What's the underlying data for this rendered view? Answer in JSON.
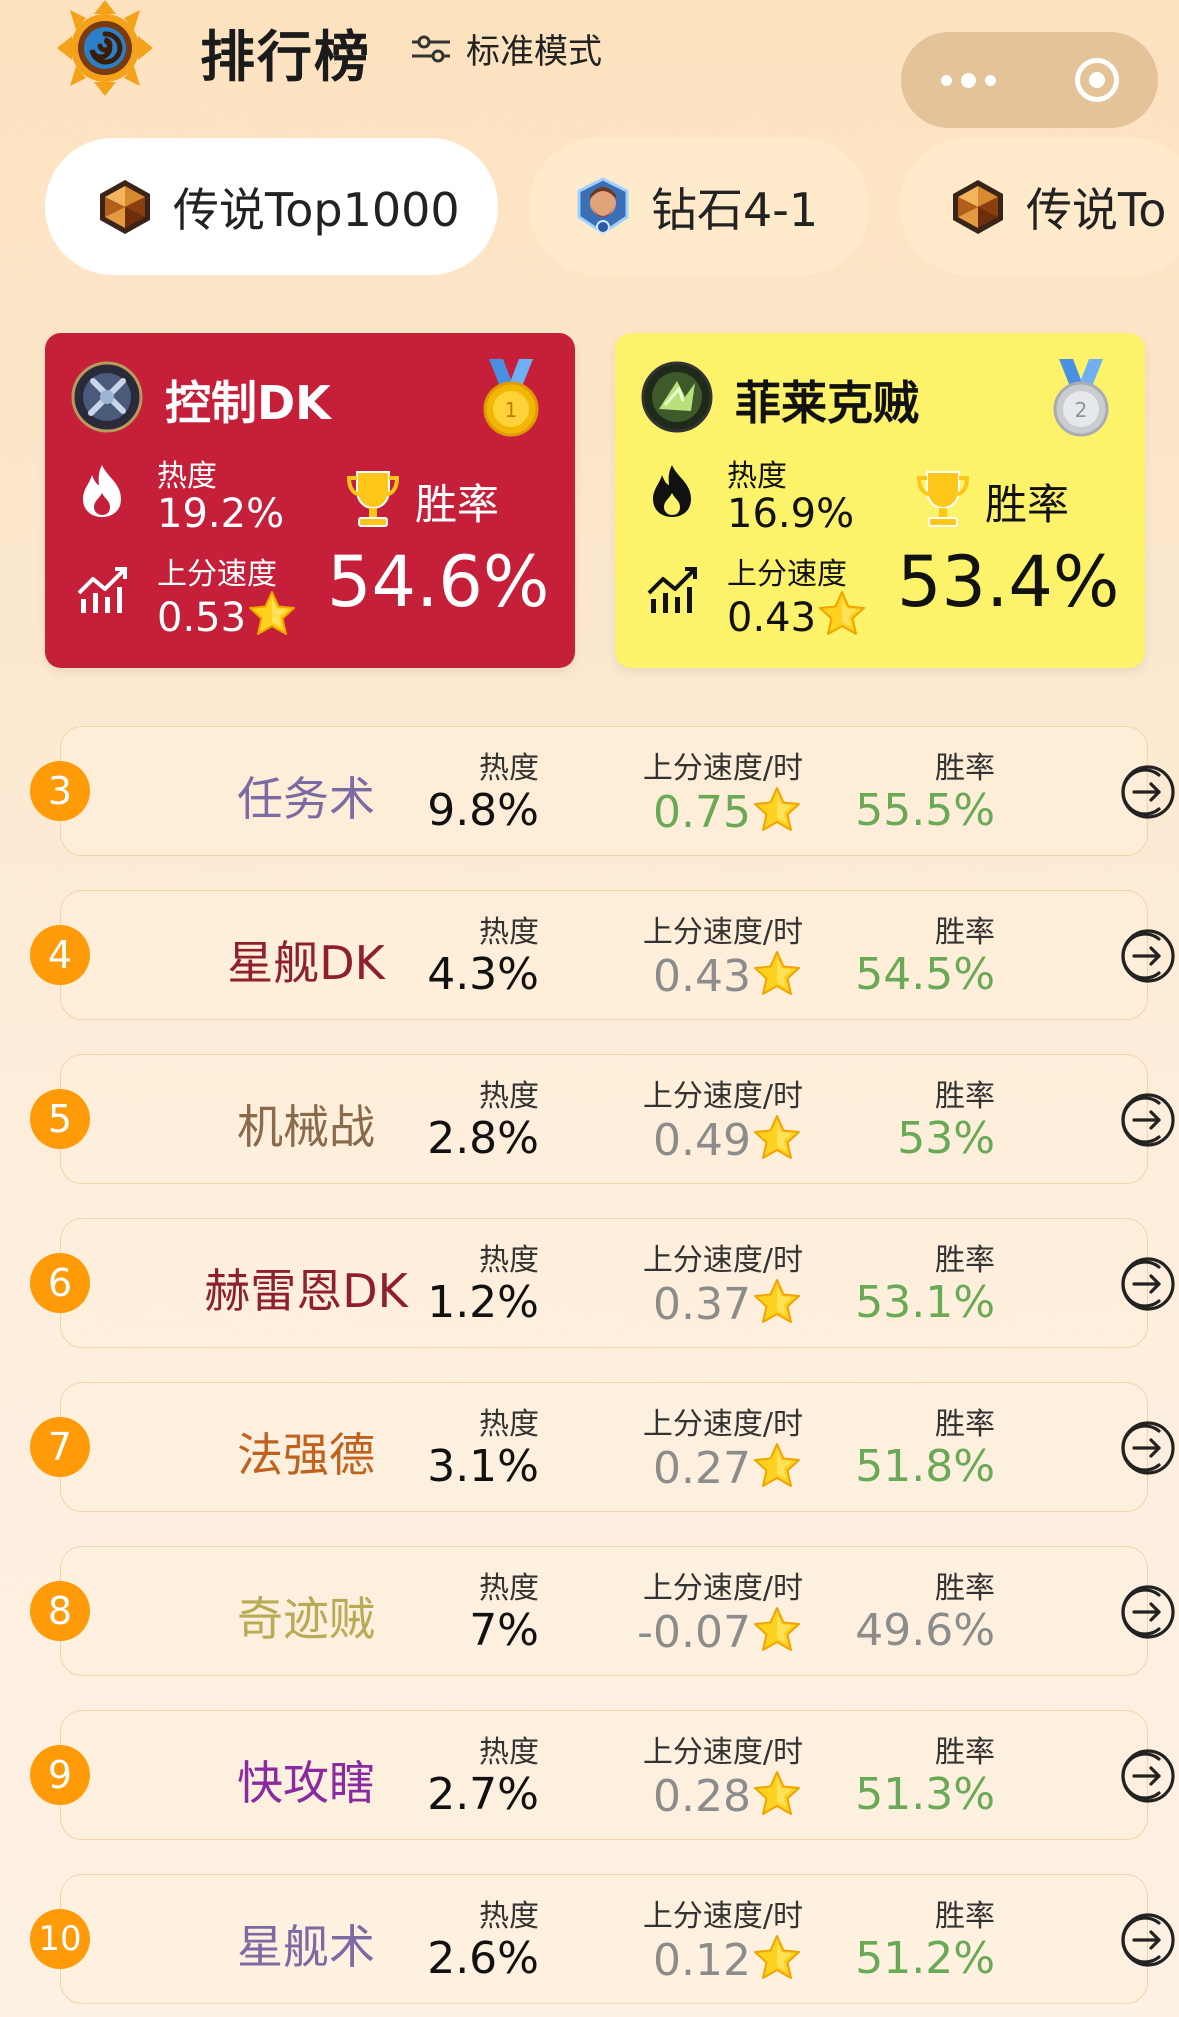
{
  "header": {
    "title": "排行榜",
    "mode_label": "标准模式"
  },
  "tabs": [
    {
      "label": "传说Top1000",
      "active": true,
      "icon": "legend-gem-icon"
    },
    {
      "label": "钻石4-1",
      "active": false,
      "icon": "diamond-rank-icon"
    },
    {
      "label": "传说To",
      "active": false,
      "icon": "legend-gem-icon"
    }
  ],
  "top_cards": [
    {
      "rank": 1,
      "name": "控制DK",
      "heat_label": "热度",
      "heat": "19.2%",
      "speed_label": "上分速度",
      "speed": "0.53",
      "winrate_label": "胜率",
      "winrate": "54.6%",
      "color": "#c51f3a",
      "medal": "gold-medal-icon"
    },
    {
      "rank": 2,
      "name": "菲莱克贼",
      "heat_label": "热度",
      "heat": "16.9%",
      "speed_label": "上分速度",
      "speed": "0.43",
      "winrate_label": "胜率",
      "winrate": "53.4%",
      "color": "#fdf36b",
      "medal": "silver-medal-icon"
    }
  ],
  "columns": {
    "heat": "热度",
    "speed": "上分速度/时",
    "winrate": "胜率"
  },
  "rows": [
    {
      "rank": "3",
      "name": "任务术",
      "name_color": "#7b6aa3",
      "heat": "9.8%",
      "speed": "0.75",
      "speed_color": "#6aa955",
      "winrate": "55.5%",
      "winrate_color": "#6aa955"
    },
    {
      "rank": "4",
      "name": "星舰DK",
      "name_color": "#8e1f2d",
      "heat": "4.3%",
      "speed": "0.43",
      "speed_color": "#8c8c8c",
      "winrate": "54.5%",
      "winrate_color": "#6aa955"
    },
    {
      "rank": "5",
      "name": "机械战",
      "name_color": "#8a6a4a",
      "heat": "2.8%",
      "speed": "0.49",
      "speed_color": "#8c8c8c",
      "winrate": "53%",
      "winrate_color": "#6aa955"
    },
    {
      "rank": "6",
      "name": "赫雷恩DK",
      "name_color": "#8e1f2d",
      "heat": "1.2%",
      "speed": "0.37",
      "speed_color": "#8c8c8c",
      "winrate": "53.1%",
      "winrate_color": "#6aa955"
    },
    {
      "rank": "7",
      "name": "法强德",
      "name_color": "#c0621d",
      "heat": "3.1%",
      "speed": "0.27",
      "speed_color": "#8c8c8c",
      "winrate": "51.8%",
      "winrate_color": "#6aa955"
    },
    {
      "rank": "8",
      "name": "奇迹贼",
      "name_color": "#b9aa55",
      "heat": "7%",
      "speed": "-0.07",
      "speed_color": "#8c8c8c",
      "winrate": "49.6%",
      "winrate_color": "#8c8c8c"
    },
    {
      "rank": "9",
      "name": "快攻瞎",
      "name_color": "#8a2aa0",
      "heat": "2.7%",
      "speed": "0.28",
      "speed_color": "#8c8c8c",
      "winrate": "51.3%",
      "winrate_color": "#6aa955"
    },
    {
      "rank": "10",
      "name": "星舰术",
      "name_color": "#7b6aa3",
      "heat": "2.6%",
      "speed": "0.12",
      "speed_color": "#8c8c8c",
      "winrate": "51.2%",
      "winrate_color": "#6aa955"
    }
  ]
}
